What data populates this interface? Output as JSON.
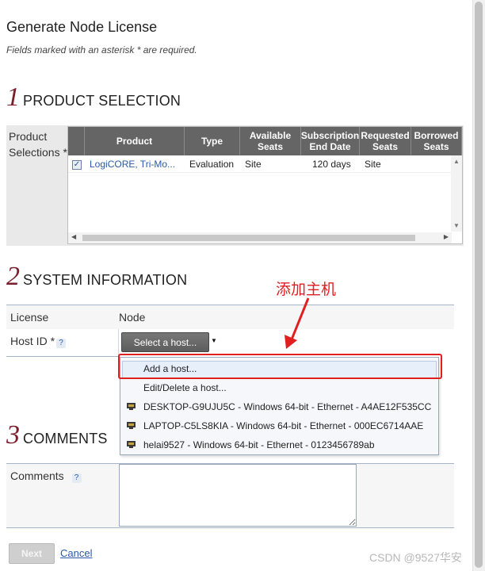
{
  "page": {
    "title": "Generate Node License",
    "subtitle": "Fields marked with an asterisk * are required."
  },
  "sections": {
    "product": {
      "num": "1",
      "title": "PRODUCT SELECTION"
    },
    "system": {
      "num": "2",
      "title": "SYSTEM INFORMATION"
    },
    "comments": {
      "num": "3",
      "title": "COMMENTS"
    }
  },
  "product_selection": {
    "label": "Product Selections *",
    "columns": [
      "",
      "Product",
      "Type",
      "Available Seats",
      "Subscription End Date",
      "Requested Seats",
      "Borrowed Seats"
    ],
    "rows": [
      {
        "checked": true,
        "product": "LogiCORE, Tri-Mo...",
        "type": "Evaluation",
        "available": "Site",
        "end_date": "120 days",
        "requested": "Site",
        "borrowed": ""
      }
    ]
  },
  "system_info": {
    "license_label": "License",
    "license_value": "Node",
    "host_label": "Host ID *",
    "help_glyph": "?",
    "select_label": "Select a host...",
    "dropdown": {
      "items": [
        {
          "label": "Add a host...",
          "icon": "",
          "highlighted": true
        },
        {
          "label": "Edit/Delete a host...",
          "icon": ""
        },
        {
          "label": "DESKTOP-G9UJU5C - Windows 64-bit - Ethernet - A4AE12F535CC",
          "icon": "network-host-icon"
        },
        {
          "label": "LAPTOP-C5LS8KIA - Windows 64-bit - Ethernet - 000EC6714AAE",
          "icon": "network-host-icon"
        },
        {
          "label": "helai9527 - Windows 64-bit - Ethernet - 0123456789ab",
          "icon": "network-host-icon"
        }
      ]
    }
  },
  "annotation": {
    "text": "添加主机",
    "color": "#e02020"
  },
  "comments": {
    "label": "Comments",
    "help_glyph": "?",
    "value": ""
  },
  "actions": {
    "next_label": "Next",
    "cancel_label": "Cancel"
  },
  "watermark": "CSDN @9527华安",
  "colors": {
    "section_number": "#7a1f2b",
    "grid_header": "#656565",
    "link": "#2a5aa8",
    "annotation": "#e02020"
  }
}
